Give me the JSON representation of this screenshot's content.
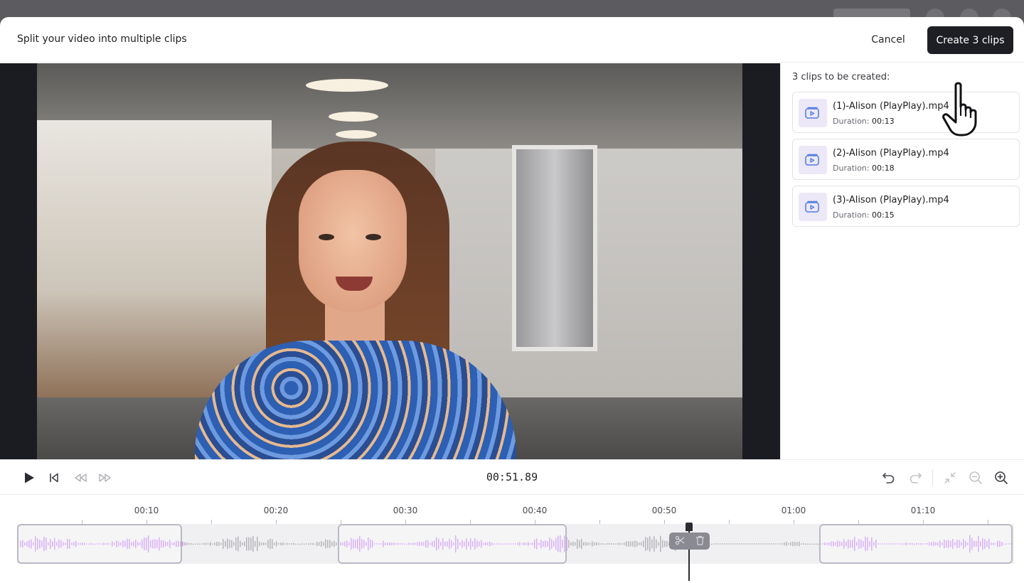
{
  "header": {
    "title": "Split your video into multiple clips",
    "cancel_label": "Cancel",
    "create_label": "Create 3 clips"
  },
  "panel": {
    "heading": "3 clips to be created:",
    "duration_label": "Duration:",
    "clips": [
      {
        "name": "(1)-Alison (PlayPlay).mp4",
        "duration": "00:13"
      },
      {
        "name": "(2)-Alison (PlayPlay).mp4",
        "duration": "00:18"
      },
      {
        "name": "(3)-Alison (PlayPlay).mp4",
        "duration": "00:15"
      }
    ]
  },
  "controls": {
    "timecode": "00:51.89",
    "icons": [
      "play-icon",
      "skip-to-start-icon",
      "rewind-icon",
      "fast-forward-icon",
      "undo-icon",
      "redo-icon",
      "collapse-icon",
      "zoom-out-icon",
      "zoom-in-icon"
    ]
  },
  "timeline": {
    "labels": [
      "00:10",
      "00:20",
      "00:30",
      "00:40",
      "00:50",
      "01:00",
      "01:10"
    ],
    "playhead_position": "00:51.89",
    "playhead_tools": [
      "scissors-icon",
      "trash-icon"
    ],
    "waveform_selected_color": "#c78cf0",
    "waveform_unselected_color": "#b8b8be"
  },
  "colors": {
    "primary_button": "#1e1f25",
    "accent_icon": "#4f7be0",
    "thumb_bg": "#ece8f8"
  }
}
